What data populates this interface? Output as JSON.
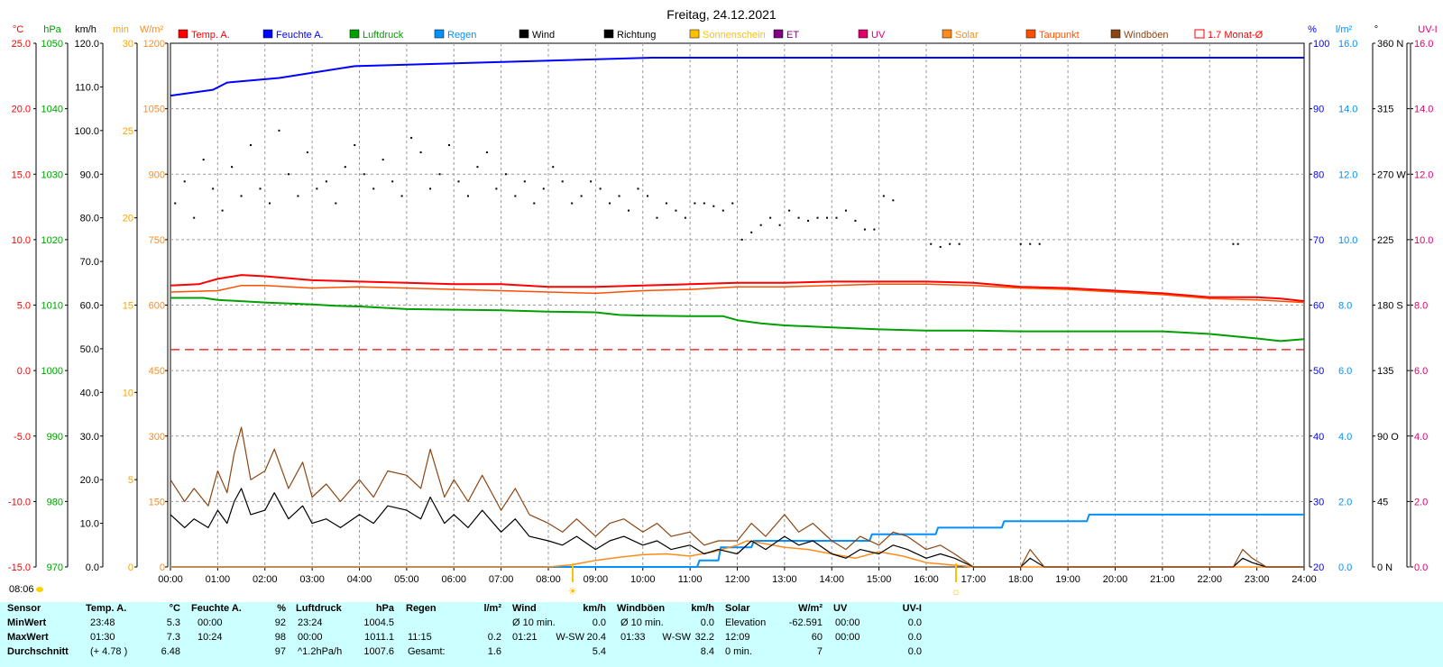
{
  "title": "Freitag, 24.12.2021",
  "start_time": "08:06",
  "legend": [
    {
      "label": "Temp. A.",
      "color": "#ff0000",
      "type": "fill"
    },
    {
      "label": "Feuchte A.",
      "color": "#0000ff",
      "type": "fill"
    },
    {
      "label": "Luftdruck",
      "color": "#00a000",
      "type": "fill"
    },
    {
      "label": "Regen",
      "color": "#0090ff",
      "type": "fill"
    },
    {
      "label": "Wind",
      "color": "#000000",
      "type": "fill"
    },
    {
      "label": "Richtung",
      "color": "#000000",
      "type": "fill"
    },
    {
      "label": "Sonnenschein",
      "color": "#ffc000",
      "type": "fill"
    },
    {
      "label": "ET",
      "color": "#800080",
      "type": "fill"
    },
    {
      "label": "UV",
      "color": "#e0006c",
      "type": "fill"
    },
    {
      "label": "Solar",
      "color": "#ff8c1a",
      "type": "fill"
    },
    {
      "label": "Taupunkt",
      "color": "#ff5000",
      "type": "fill"
    },
    {
      "label": "Windböen",
      "color": "#8b4513",
      "type": "fill"
    },
    {
      "label": "1.7 Monat-Ø",
      "color": "#ff0000",
      "type": "outline"
    }
  ],
  "left_axes": [
    {
      "unit": "°C",
      "color": "#ff0000",
      "ticks": [
        "25.0",
        "20.0",
        "15.0",
        "10.0",
        "5.0",
        "0.0",
        "-5.0",
        "-10.0",
        "-15.0"
      ]
    },
    {
      "unit": "hPa",
      "color": "#00a000",
      "ticks": [
        "1050",
        "1040",
        "1030",
        "1020",
        "1010",
        "1000",
        "990",
        "980",
        "970"
      ]
    },
    {
      "unit": "km/h",
      "color": "#000000",
      "ticks": [
        "120.0",
        "110.0",
        "100.0",
        "90.0",
        "80.0",
        "70.0",
        "60.0",
        "50.0",
        "40.0",
        "30.0",
        "20.0",
        "10.0",
        "0.0"
      ]
    },
    {
      "unit": "min",
      "color": "#ffa500",
      "ticks": [
        "30",
        "25",
        "20",
        "15",
        "10",
        "5",
        "0"
      ]
    },
    {
      "unit": "W/m²",
      "color": "#ff8c1a",
      "ticks": [
        "1200",
        "1050",
        "900",
        "750",
        "600",
        "450",
        "300",
        "150",
        "0"
      ]
    }
  ],
  "right_axes": [
    {
      "unit": "%",
      "color": "#0000ff",
      "ticks": [
        "100",
        "90",
        "80",
        "70",
        "60",
        "50",
        "40",
        "30",
        "20"
      ]
    },
    {
      "unit": "l/m²",
      "color": "#0090ff",
      "ticks": [
        "16.0",
        "14.0",
        "12.0",
        "10.0",
        "8.0",
        "6.0",
        "4.0",
        "2.0",
        "0.0"
      ]
    },
    {
      "unit": "°",
      "color": "#000000",
      "ticks": [
        "360 N",
        "315",
        "270 W",
        "225",
        "180 S",
        "135",
        "90 O",
        "45",
        "0 N"
      ]
    },
    {
      "unit": "UV-I",
      "color": "#e0006c",
      "ticks": [
        "16.0",
        "14.0",
        "12.0",
        "10.0",
        "8.0",
        "6.0",
        "4.0",
        "2.0",
        "0.0"
      ]
    }
  ],
  "x_ticks": [
    "00:00",
    "01:00",
    "02:00",
    "03:00",
    "04:00",
    "05:00",
    "06:00",
    "07:00",
    "08:00",
    "09:00",
    "10:00",
    "11:00",
    "12:00",
    "13:00",
    "14:00",
    "15:00",
    "16:00",
    "17:00",
    "18:00",
    "19:00",
    "20:00",
    "21:00",
    "22:00",
    "23:00",
    "24:00"
  ],
  "stats_table": {
    "columns": [
      {
        "header": "Sensor",
        "unit": ""
      },
      {
        "header": "Temp. A.",
        "unit": "°C"
      },
      {
        "header": "Feuchte A.",
        "unit": "%"
      },
      {
        "header": "Luftdruck",
        "unit": "hPa"
      },
      {
        "header": "Regen",
        "unit": "l/m²"
      },
      {
        "header": "Wind",
        "unit": "km/h"
      },
      {
        "header": "Windböen",
        "unit": "km/h"
      },
      {
        "header": "Solar",
        "unit": "W/m²"
      },
      {
        "header": "UV",
        "unit": "UV-I"
      }
    ],
    "rows": [
      {
        "label": "MinWert",
        "temp_time": "23:48",
        "temp": "5.3",
        "hum_time": "00:00",
        "hum": "92",
        "press_time": "23:24",
        "press": "1004.5",
        "rain_time": "",
        "rain": "",
        "wind_time": "Ø 10 min.",
        "wind_dir": "",
        "wind": "0.0",
        "gust_time": "Ø 10 min.",
        "gust_dir": "",
        "gust": "0.0",
        "solar_time": "Elevation",
        "solar": "-62.591",
        "uv_time": "00:00",
        "uv": "0.0"
      },
      {
        "label": "MaxWert",
        "temp_time": "01:30",
        "temp": "7.3",
        "hum_time": "10:24",
        "hum": "98",
        "press_time": "00:00",
        "press": "1011.1",
        "rain_time": "11:15",
        "rain": "0.2",
        "wind_time": "01:21",
        "wind_dir": "W-SW",
        "wind": "20.4",
        "gust_time": "01:33",
        "gust_dir": "W-SW",
        "gust": "32.2",
        "solar_time": "12:09",
        "solar": "60",
        "uv_time": "00:00",
        "uv": "0.0"
      },
      {
        "label": "Durchschnitt",
        "temp_time": "(+ 4.78 )",
        "temp": "6.48",
        "hum_time": "",
        "hum": "97",
        "press_time": "^1.2hPa/h",
        "press": "1007.6",
        "rain_time": "Gesamt:",
        "rain": "1.6",
        "wind_time": "",
        "wind_dir": "",
        "wind": "5.4",
        "gust_time": "",
        "gust_dir": "",
        "gust": "8.4",
        "solar_time": "0 min.",
        "solar": "7",
        "uv_time": "",
        "uv": "0.0"
      }
    ]
  },
  "chart_data": {
    "type": "line",
    "title": "Freitag, 24.12.2021",
    "x_unit": "hours",
    "xlim": [
      0,
      24
    ],
    "series": [
      {
        "name": "Temp. A.",
        "unit": "°C",
        "color": "#ff0000",
        "x": [
          0,
          0.6,
          1,
          1.5,
          2,
          3,
          4,
          5,
          6,
          7,
          8,
          9,
          10,
          11,
          12,
          13,
          14,
          15,
          16,
          17,
          18,
          19,
          20,
          21,
          22,
          23,
          23.5,
          24
        ],
        "values": [
          6.5,
          6.6,
          7.0,
          7.3,
          7.2,
          6.9,
          6.8,
          6.7,
          6.6,
          6.6,
          6.4,
          6.4,
          6.5,
          6.6,
          6.7,
          6.7,
          6.8,
          6.8,
          6.8,
          6.7,
          6.4,
          6.3,
          6.1,
          5.9,
          5.6,
          5.6,
          5.5,
          5.3
        ]
      },
      {
        "name": "Taupunkt",
        "unit": "°C",
        "color": "#ff5000",
        "x": [
          0,
          1,
          1.5,
          2,
          3,
          4,
          5,
          6,
          7,
          8,
          9,
          10,
          11,
          12,
          13,
          14,
          15,
          16,
          17,
          18,
          19,
          20,
          21,
          22,
          23,
          24
        ],
        "values": [
          6.0,
          6.1,
          6.5,
          6.5,
          6.3,
          6.4,
          6.3,
          6.2,
          6.1,
          6.0,
          5.9,
          6.1,
          6.2,
          6.4,
          6.4,
          6.5,
          6.6,
          6.6,
          6.5,
          6.3,
          6.2,
          6.0,
          5.8,
          5.5,
          5.4,
          5.2
        ]
      },
      {
        "name": "Luftdruck",
        "unit": "hPa",
        "color": "#00a000",
        "x": [
          0,
          0.7,
          1,
          2,
          3,
          3.5,
          4,
          5,
          6,
          7,
          8,
          9,
          9.5,
          10,
          11,
          11.7,
          12,
          12.5,
          13,
          14,
          15,
          16,
          17,
          18,
          19,
          20,
          21,
          22,
          23,
          23.5,
          24
        ],
        "values": [
          1011.1,
          1011.1,
          1010.8,
          1010.4,
          1010.1,
          1009.9,
          1009.8,
          1009.4,
          1009.3,
          1009.2,
          1009.0,
          1008.9,
          1008.5,
          1008.4,
          1008.3,
          1008.3,
          1007.7,
          1007.2,
          1006.9,
          1006.6,
          1006.3,
          1006.1,
          1006.1,
          1006.0,
          1006.0,
          1006.0,
          1006.0,
          1005.6,
          1004.9,
          1004.5,
          1004.8
        ]
      },
      {
        "name": "Feuchte A.",
        "unit": "%",
        "color": "#0000ff",
        "x": [
          0,
          0.9,
          1.2,
          2.3,
          3.0,
          3.9,
          10.2,
          24
        ],
        "values": [
          92,
          92.9,
          94,
          94.7,
          95.5,
          96.5,
          97.8,
          97.8
        ]
      },
      {
        "name": "Regen",
        "unit": "l/m²",
        "color": "#0090ff",
        "x": [
          0,
          11.15,
          11.2,
          11.6,
          11.65,
          12.3,
          12.35,
          14.8,
          14.85,
          16.2,
          16.25,
          17.6,
          17.65,
          19.4,
          19.45,
          24
        ],
        "values": [
          0,
          0,
          0.2,
          0.2,
          0.6,
          0.6,
          0.8,
          0.8,
          1.0,
          1.0,
          1.2,
          1.2,
          1.4,
          1.4,
          1.6,
          1.6
        ]
      },
      {
        "name": "Solar",
        "unit": "W/m²",
        "color": "#ff8c1a",
        "x": [
          0,
          8,
          8.5,
          9,
          9.5,
          10,
          10.5,
          11,
          11.5,
          12,
          12.2,
          12.5,
          13,
          13.5,
          14,
          14.5,
          15,
          15.5,
          16,
          16.5,
          17,
          24
        ],
        "values": [
          0,
          0,
          5,
          15,
          22,
          28,
          30,
          25,
          35,
          50,
          60,
          55,
          45,
          40,
          30,
          20,
          35,
          25,
          10,
          5,
          0,
          0
        ]
      },
      {
        "name": "Wind",
        "unit": "km/h",
        "color": "#000000",
        "x": [
          0,
          0.3,
          0.5,
          0.8,
          1.0,
          1.2,
          1.35,
          1.5,
          1.7,
          2.0,
          2.2,
          2.5,
          2.8,
          3.0,
          3.3,
          3.6,
          4.0,
          4.3,
          4.6,
          5.0,
          5.3,
          5.5,
          5.8,
          6.0,
          6.3,
          6.6,
          7.0,
          7.3,
          7.6,
          8.0,
          8.3,
          8.6,
          9.0,
          9.3,
          9.6,
          10.0,
          10.3,
          10.6,
          11.0,
          11.3,
          11.6,
          12.0,
          12.3,
          12.6,
          13.0,
          13.3,
          13.6,
          14.0,
          14.3,
          14.6,
          15.0,
          15.3,
          15.6,
          16.0,
          16.3,
          16.6,
          17.0,
          17.5,
          18.0,
          18.2,
          18.5,
          19.0,
          22.5,
          22.7,
          22.9,
          23.2,
          24
        ],
        "values": [
          12,
          9,
          11,
          9,
          13,
          10,
          15,
          18,
          12,
          13,
          17,
          11,
          14,
          10,
          11,
          9,
          12,
          10,
          14,
          13,
          11,
          16,
          10,
          12,
          9,
          13,
          8,
          11,
          7,
          6,
          5,
          7,
          4,
          6,
          7,
          5,
          6,
          4,
          5,
          3,
          4,
          3,
          6,
          4,
          7,
          5,
          6,
          3,
          2,
          4,
          3,
          5,
          4,
          2,
          3,
          2,
          0,
          0,
          0,
          2,
          0,
          0,
          0,
          2,
          1,
          0,
          0
        ]
      },
      {
        "name": "Windböen",
        "unit": "km/h",
        "color": "#8b4513",
        "x": [
          0,
          0.3,
          0.5,
          0.8,
          1.0,
          1.2,
          1.35,
          1.5,
          1.7,
          2.0,
          2.2,
          2.5,
          2.8,
          3.0,
          3.3,
          3.6,
          4.0,
          4.3,
          4.6,
          5.0,
          5.3,
          5.5,
          5.8,
          6.0,
          6.3,
          6.6,
          7.0,
          7.3,
          7.6,
          8.0,
          8.3,
          8.6,
          9.0,
          9.3,
          9.6,
          10.0,
          10.3,
          10.6,
          11.0,
          11.3,
          11.6,
          12.0,
          12.3,
          12.6,
          13.0,
          13.3,
          13.6,
          14.0,
          14.3,
          14.6,
          15.0,
          15.3,
          15.6,
          16.0,
          16.3,
          16.6,
          17.0,
          17.5,
          18.0,
          18.2,
          18.5,
          19.0,
          22.5,
          22.7,
          22.9,
          23.2,
          24
        ],
        "values": [
          20,
          15,
          18,
          14,
          22,
          17,
          26,
          32,
          20,
          22,
          27,
          18,
          24,
          16,
          19,
          15,
          20,
          16,
          22,
          21,
          18,
          27,
          16,
          20,
          15,
          21,
          13,
          18,
          12,
          10,
          8,
          11,
          7,
          10,
          11,
          8,
          10,
          7,
          8,
          5,
          6,
          6,
          10,
          7,
          12,
          8,
          10,
          6,
          4,
          7,
          5,
          8,
          7,
          4,
          5,
          3,
          0,
          0,
          0,
          4,
          0,
          0,
          0,
          4,
          2,
          0,
          0
        ]
      },
      {
        "name": "Richtung",
        "unit": "°",
        "color": "#000000",
        "style": "dots",
        "x": [
          0.1,
          0.3,
          0.5,
          0.7,
          0.9,
          1.1,
          1.3,
          1.5,
          1.7,
          1.9,
          2.1,
          2.3,
          2.5,
          2.7,
          2.9,
          3.1,
          3.3,
          3.5,
          3.7,
          3.9,
          4.1,
          4.3,
          4.5,
          4.7,
          4.9,
          5.1,
          5.3,
          5.5,
          5.7,
          5.9,
          6.1,
          6.3,
          6.5,
          6.7,
          6.9,
          7.1,
          7.3,
          7.5,
          7.7,
          7.9,
          8.1,
          8.3,
          8.5,
          8.7,
          8.9,
          9.1,
          9.3,
          9.5,
          9.7,
          9.9,
          10.1,
          10.3,
          10.5,
          10.7,
          10.9,
          11.1,
          11.3,
          11.5,
          11.7,
          11.9,
          12.1,
          12.3,
          12.5,
          12.7,
          12.9,
          13.1,
          13.3,
          13.5,
          13.7,
          13.9,
          14.1,
          14.3,
          14.5,
          14.7,
          14.9,
          15.1,
          15.3,
          16.1,
          16.3,
          16.5,
          16.7,
          18.0,
          18.2,
          18.4,
          22.5,
          22.6
        ],
        "values": [
          250,
          265,
          240,
          280,
          260,
          245,
          275,
          255,
          290,
          260,
          250,
          300,
          270,
          255,
          285,
          260,
          265,
          250,
          275,
          290,
          270,
          260,
          280,
          265,
          255,
          295,
          285,
          260,
          270,
          290,
          265,
          255,
          275,
          285,
          260,
          270,
          255,
          265,
          250,
          260,
          275,
          265,
          250,
          255,
          265,
          260,
          250,
          255,
          245,
          260,
          255,
          240,
          250,
          245,
          240,
          250,
          250,
          248,
          245,
          250,
          225,
          230,
          235,
          240,
          235,
          245,
          240,
          238,
          240,
          240,
          240,
          245,
          238,
          232,
          232,
          255,
          252,
          222,
          220,
          222,
          222,
          222,
          222,
          222,
          222,
          222
        ]
      }
    ],
    "reference_lines": [
      {
        "name": "1.7 Monat-Ø",
        "unit": "°C",
        "value": 1.6,
        "color": "#ff0000",
        "style": "dashed"
      }
    ]
  }
}
